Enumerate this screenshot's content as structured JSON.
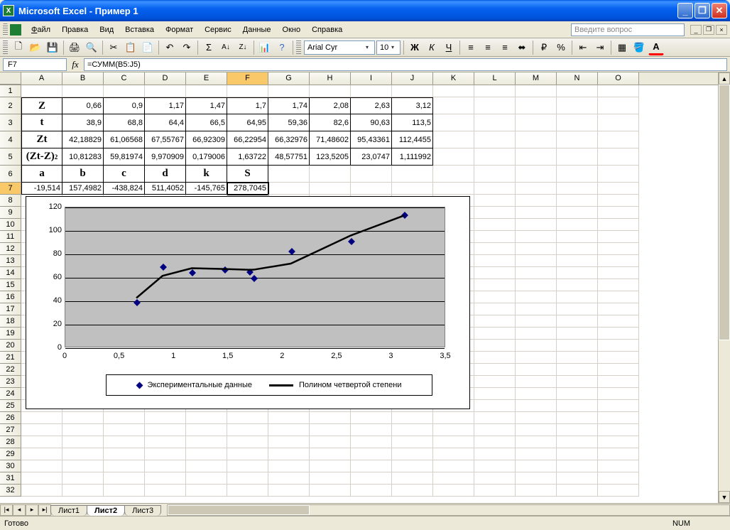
{
  "title": "Microsoft Excel - Пример 1",
  "menu": {
    "file": "Файл",
    "edit": "Правка",
    "view": "Вид",
    "insert": "Вставка",
    "format": "Формат",
    "tools": "Сервис",
    "data": "Данные",
    "window": "Окно",
    "help": "Справка"
  },
  "question_placeholder": "Введите вопрос",
  "font_name": "Arial Cyr",
  "font_size": "10",
  "namebox": "F7",
  "formula": "=СУММ(B5:J5)",
  "columns": [
    "A",
    "B",
    "C",
    "D",
    "E",
    "F",
    "G",
    "H",
    "I",
    "J",
    "K",
    "L",
    "M",
    "N",
    "O"
  ],
  "table": {
    "row_labels": [
      "Z",
      "t",
      "Zt",
      "(Zt-Z)",
      "a",
      "b",
      "c",
      "d",
      "k",
      "S"
    ],
    "Z": [
      "0,66",
      "0,9",
      "1,17",
      "1,47",
      "1,7",
      "1,74",
      "2,08",
      "2,63",
      "3,12"
    ],
    "t": [
      "38,9",
      "68,8",
      "64,4",
      "66,5",
      "64,95",
      "59,36",
      "82,6",
      "90,63",
      "113,5"
    ],
    "Zt": [
      "42,18829",
      "61,06568",
      "67,55767",
      "66,92309",
      "66,22954",
      "66,32976",
      "71,48602",
      "95,43361",
      "112,4455"
    ],
    "ZtZ2": [
      "10,81283",
      "59,81974",
      "9,970909",
      "0,179006",
      "1,63722",
      "48,57751",
      "123,5205",
      "23,0747",
      "1,111992"
    ],
    "params_h": [
      "a",
      "b",
      "c",
      "d",
      "k",
      "S"
    ],
    "params": [
      "-19,514",
      "157,4982",
      "-438,824",
      "511,4052",
      "-145,765",
      "278,7045"
    ]
  },
  "chart_data": {
    "type": "scatter+line",
    "title": "",
    "xlabel": "",
    "ylabel": "",
    "xlim": [
      0,
      3.5
    ],
    "ylim": [
      0,
      120
    ],
    "xticks": [
      0,
      0.5,
      1,
      1.5,
      2,
      2.5,
      3,
      3.5
    ],
    "yticks": [
      0,
      20,
      40,
      60,
      80,
      100,
      120
    ],
    "series": [
      {
        "name": "Экспериментальные данные",
        "type": "scatter",
        "x": [
          0.66,
          0.9,
          1.17,
          1.47,
          1.7,
          1.74,
          2.08,
          2.63,
          3.12
        ],
        "y": [
          38.9,
          68.8,
          64.4,
          66.5,
          64.95,
          59.36,
          82.6,
          90.63,
          113.5
        ]
      },
      {
        "name": "Полином четвертой степени",
        "type": "line",
        "x": [
          0.66,
          0.9,
          1.17,
          1.47,
          1.7,
          1.74,
          2.08,
          2.63,
          3.12
        ],
        "y": [
          42.19,
          61.07,
          67.56,
          66.92,
          66.23,
          66.33,
          71.49,
          95.43,
          112.45
        ]
      }
    ]
  },
  "sheets": [
    "Лист1",
    "Лист2",
    "Лист3"
  ],
  "active_sheet": 1,
  "status": "Готово",
  "numlock": "NUM"
}
